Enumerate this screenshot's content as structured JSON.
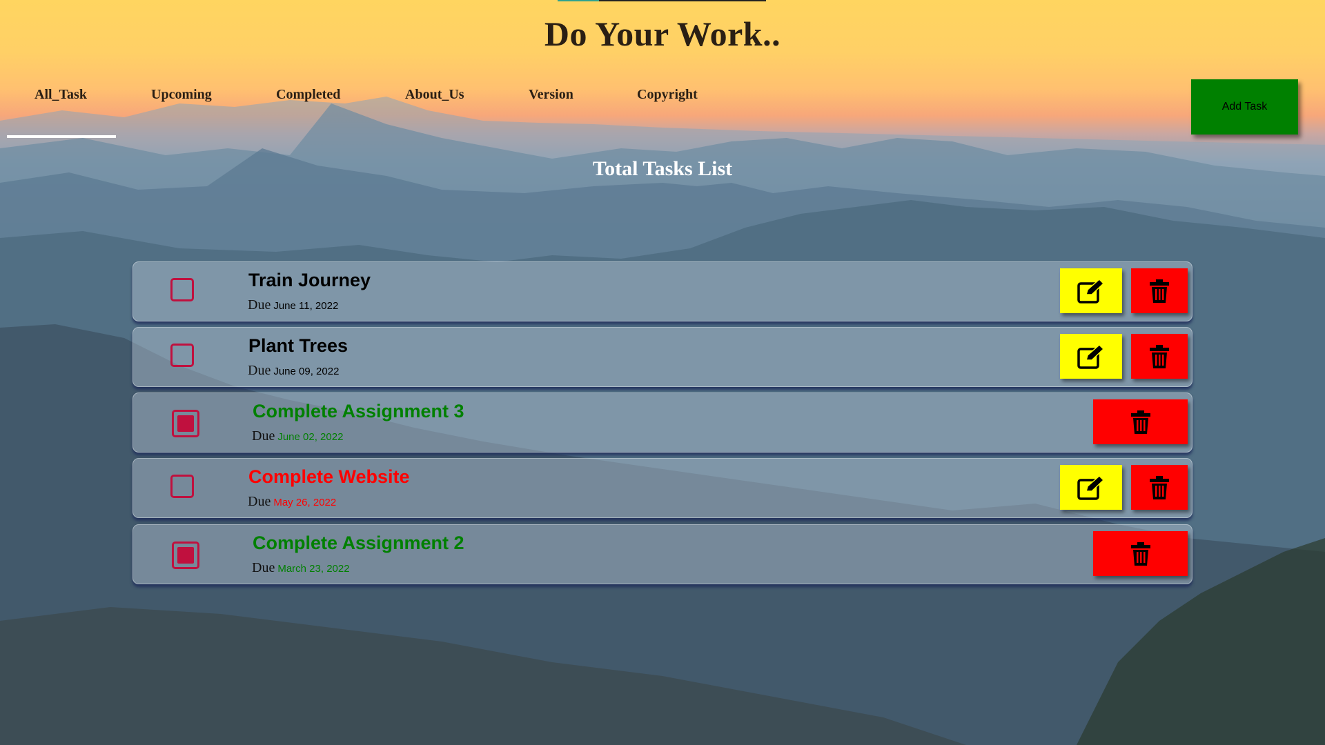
{
  "app": {
    "title": "Do Your Work.."
  },
  "nav": {
    "items": [
      {
        "label": "All_Task",
        "active": true
      },
      {
        "label": "Upcoming",
        "active": false
      },
      {
        "label": "Completed",
        "active": false
      },
      {
        "label": "About_Us",
        "active": false
      },
      {
        "label": "Version",
        "active": false
      },
      {
        "label": "Copyright",
        "active": false
      }
    ]
  },
  "toolbar": {
    "add_task_label": "Add Task"
  },
  "list": {
    "heading": "Total Tasks List",
    "due_prefix": "Due",
    "tasks": [
      {
        "name": "Train Journey",
        "due": "June 11, 2022",
        "completed": false,
        "status": "pending",
        "color": "#000000",
        "editable": true
      },
      {
        "name": "Plant Trees",
        "due": "June 09, 2022",
        "completed": false,
        "status": "pending",
        "color": "#000000",
        "editable": true
      },
      {
        "name": "Complete Assignment 3",
        "due": "June 02, 2022",
        "completed": true,
        "status": "completed",
        "color": "#008000",
        "editable": false
      },
      {
        "name": "Complete Website",
        "due": "May 26, 2022",
        "completed": false,
        "status": "overdue",
        "color": "#ff0000",
        "editable": true
      },
      {
        "name": "Complete Assignment 2",
        "due": "March 23, 2022",
        "completed": true,
        "status": "completed",
        "color": "#008000",
        "editable": false
      }
    ]
  },
  "icons": {
    "edit": "edit-icon",
    "delete": "trash-icon"
  },
  "colors": {
    "add_button": "#008000",
    "edit_button": "#ffff00",
    "delete_button": "#ff0000",
    "checkbox": "#c0103e",
    "completed_text": "#008000",
    "overdue_text": "#ff0000"
  }
}
